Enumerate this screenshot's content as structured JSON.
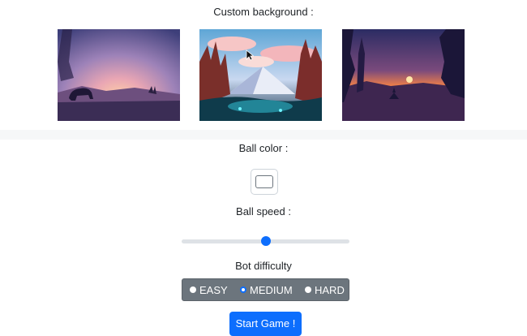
{
  "background_section": {
    "label": "Custom background :",
    "options": [
      {
        "scene": "bear-at-dusk"
      },
      {
        "scene": "snowy-mountain-forest"
      },
      {
        "scene": "forest-sunset"
      }
    ]
  },
  "ball_color": {
    "label": "Ball color :",
    "value": "#ffffff"
  },
  "ball_speed": {
    "label": "Ball speed :",
    "value_fraction": 0.5
  },
  "bot_difficulty": {
    "label": "Bot difficulty",
    "options": [
      "EASY",
      "MEDIUM",
      "HARD"
    ],
    "selected": "MEDIUM"
  },
  "start_button": {
    "label": "Start Game !"
  },
  "colors": {
    "accent": "#0d6efd",
    "radio_group_bg": "#6c757d"
  }
}
